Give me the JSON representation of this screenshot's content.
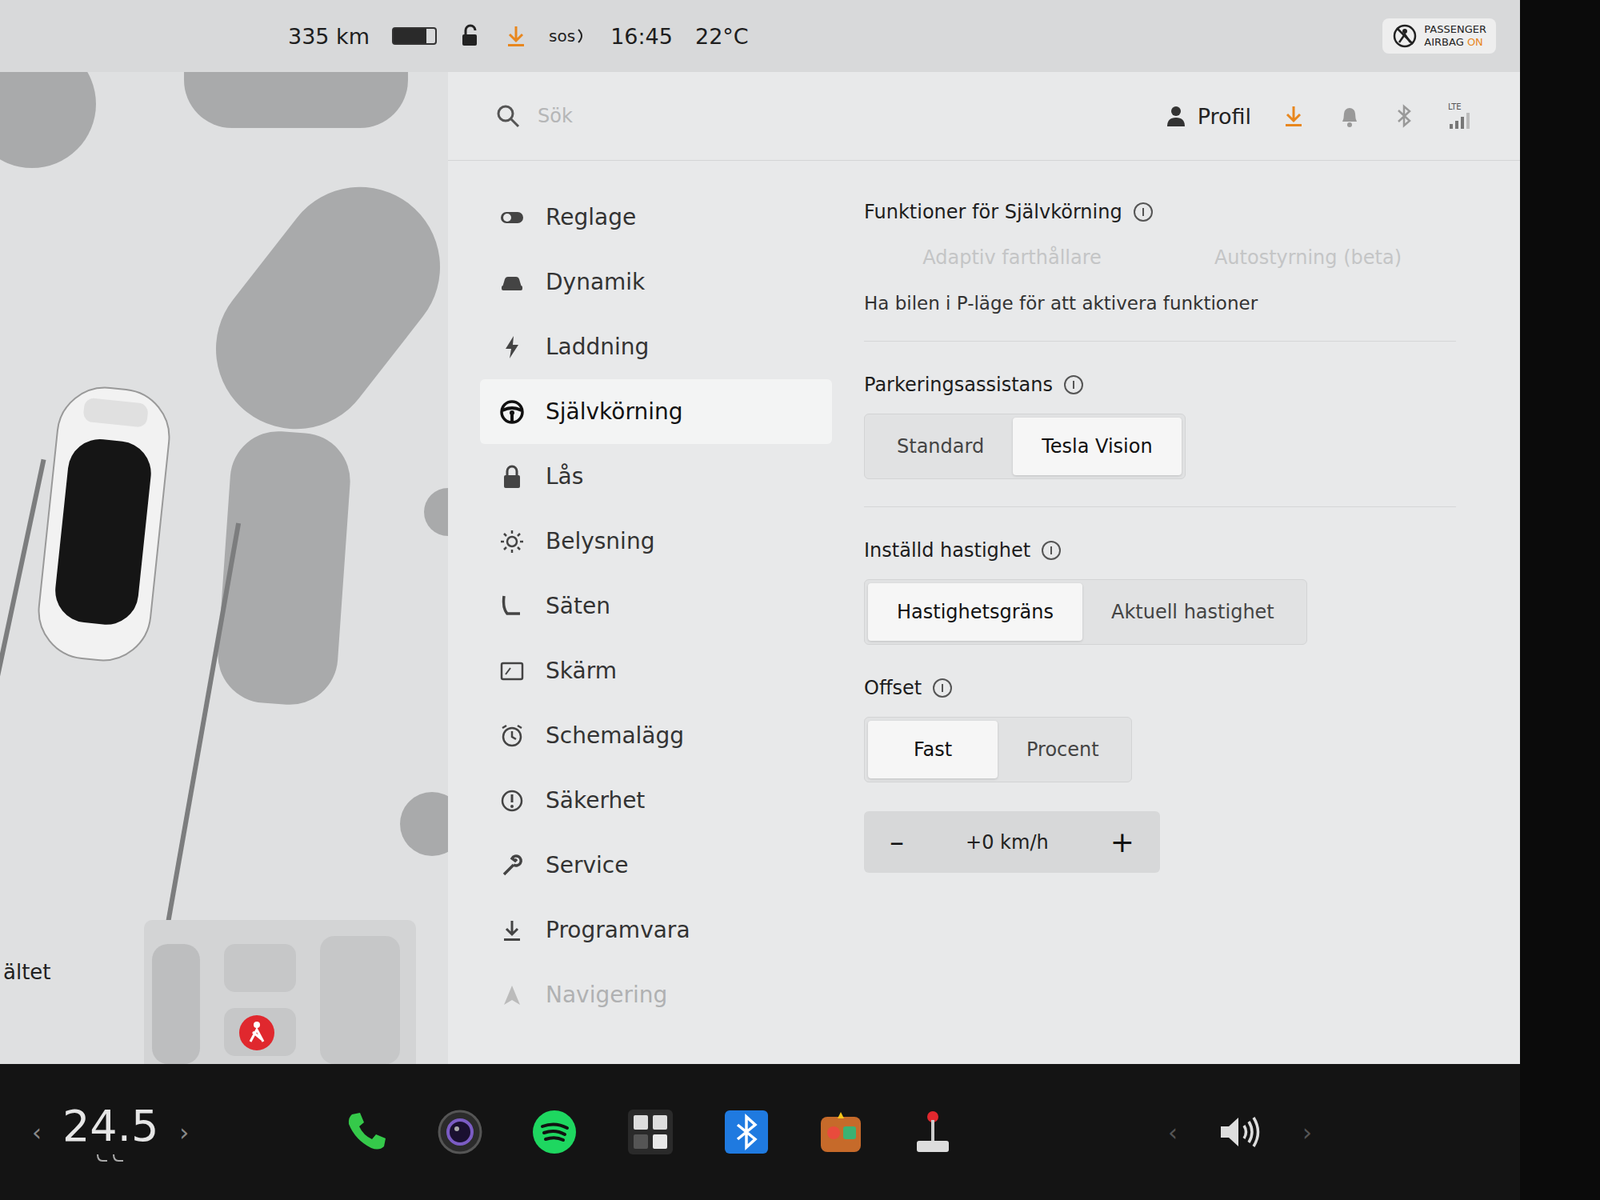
{
  "status_bar": {
    "range": "335 km",
    "battery_level": 0.78,
    "sos": "sos",
    "time": "16:45",
    "temperature": "22°C",
    "airbag": {
      "line1": "PASSENGER",
      "line2": "AIRBAG",
      "state": "ON"
    }
  },
  "car_view": {
    "label": "ältet"
  },
  "header": {
    "search_placeholder": "Sök",
    "profile": "Profil",
    "lte": "LTE"
  },
  "sidebar": {
    "items": [
      {
        "label": "Reglage",
        "selected": false,
        "faded": false
      },
      {
        "label": "Dynamik",
        "selected": false,
        "faded": false
      },
      {
        "label": "Laddning",
        "selected": false,
        "faded": false
      },
      {
        "label": "Självkörning",
        "selected": true,
        "faded": false
      },
      {
        "label": "Lås",
        "selected": false,
        "faded": false
      },
      {
        "label": "Belysning",
        "selected": false,
        "faded": false
      },
      {
        "label": "Säten",
        "selected": false,
        "faded": false
      },
      {
        "label": "Skärm",
        "selected": false,
        "faded": false
      },
      {
        "label": "Schemalägg",
        "selected": false,
        "faded": false
      },
      {
        "label": "Säkerhet",
        "selected": false,
        "faded": false
      },
      {
        "label": "Service",
        "selected": false,
        "faded": false
      },
      {
        "label": "Programvara",
        "selected": false,
        "faded": false
      },
      {
        "label": "Navigering",
        "selected": false,
        "faded": true
      }
    ]
  },
  "autopilot": {
    "title": "Funktioner för Självkörning",
    "options": [
      {
        "label": "Adaptiv farthållare",
        "disabled": true
      },
      {
        "label": "Autostyrning (beta)",
        "disabled": true
      }
    ],
    "note": "Ha bilen i P-läge för att aktivera funktioner"
  },
  "parking": {
    "title": "Parkeringsassistans",
    "options": [
      {
        "label": "Standard",
        "selected": false
      },
      {
        "label": "Tesla Vision",
        "selected": true
      }
    ]
  },
  "set_speed": {
    "title": "Inställd hastighet",
    "options": [
      {
        "label": "Hastighetsgräns",
        "selected": true
      },
      {
        "label": "Aktuell hastighet",
        "selected": false
      }
    ]
  },
  "offset": {
    "title": "Offset",
    "options": [
      {
        "label": "Fast",
        "selected": true
      },
      {
        "label": "Procent",
        "selected": false
      }
    ],
    "stepper": {
      "minus": "–",
      "value": "+0 km/h",
      "plus": "+"
    }
  },
  "taskbar": {
    "temp_left": "‹",
    "temperature": "24.5",
    "temp_right": "›",
    "volume_left": "‹",
    "volume_right": "›"
  }
}
